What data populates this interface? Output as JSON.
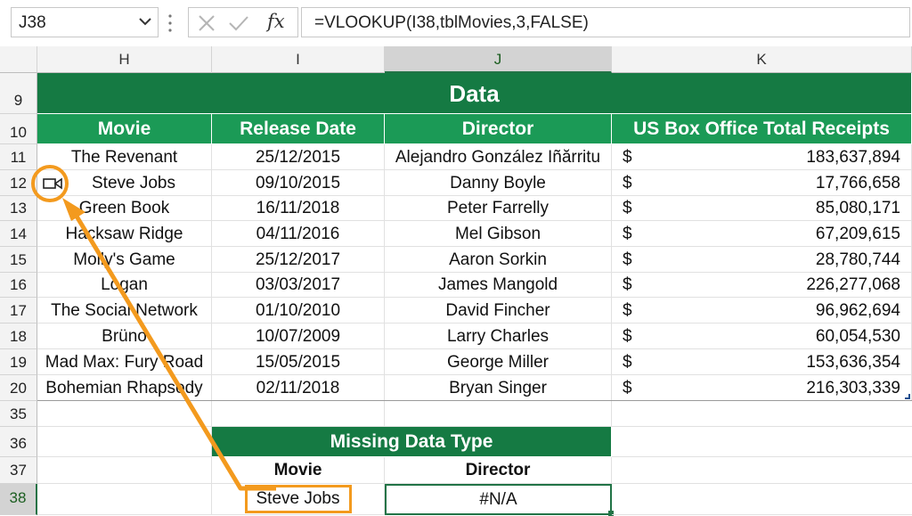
{
  "formula_bar": {
    "name_box": "J38",
    "formula": "=VLOOKUP(I38,tblMovies,3,FALSE)",
    "fx_label": "fx"
  },
  "columns": [
    "H",
    "I",
    "J",
    "K"
  ],
  "rows": {
    "r9": "9",
    "r10": "10",
    "r11": "11",
    "r12": "12",
    "r13": "13",
    "r14": "14",
    "r15": "15",
    "r16": "16",
    "r17": "17",
    "r18": "18",
    "r19": "19",
    "r20": "20",
    "r35": "35",
    "r36": "36",
    "r37": "37",
    "r38": "38"
  },
  "data_table": {
    "title": "Data",
    "headers": [
      "Movie",
      "Release Date",
      "Director",
      "US Box Office Total Receipts"
    ],
    "currency_symbol": "$",
    "rows": [
      {
        "movie": "The Revenant",
        "date": "25/12/2015",
        "director": "Alejandro González Iñărritu",
        "receipts": "183,637,894"
      },
      {
        "movie": "Steve Jobs",
        "date": "09/10/2015",
        "director": "Danny Boyle",
        "receipts": "17,766,658"
      },
      {
        "movie": "Green Book",
        "date": "16/11/2018",
        "director": "Peter Farrelly",
        "receipts": "85,080,171"
      },
      {
        "movie": "Hacksaw Ridge",
        "date": "04/11/2016",
        "director": "Mel Gibson",
        "receipts": "67,209,615"
      },
      {
        "movie": "Molly's Game",
        "date": "25/12/2017",
        "director": "Aaron Sorkin",
        "receipts": "28,780,744"
      },
      {
        "movie": "Logan",
        "date": "03/03/2017",
        "director": "James Mangold",
        "receipts": "226,277,068"
      },
      {
        "movie": "The Social Network",
        "date": "01/10/2010",
        "director": "David Fincher",
        "receipts": "96,962,694"
      },
      {
        "movie": "Brüno",
        "date": "10/07/2009",
        "director": "Larry Charles",
        "receipts": "60,054,530"
      },
      {
        "movie": "Mad Max: Fury Road",
        "date": "15/05/2015",
        "director": "George Miller",
        "receipts": "153,636,354"
      },
      {
        "movie": "Bohemian Rhapsody",
        "date": "02/11/2018",
        "director": "Bryan Singer",
        "receipts": "216,303,339"
      }
    ]
  },
  "missing_table": {
    "title": "Missing Data Type",
    "headers": [
      "Movie",
      "Director"
    ],
    "movie": "Steve Jobs",
    "director": "#N/A"
  },
  "colors": {
    "header_green": "#1b9a56",
    "title_green": "#157a43",
    "annotation_orange": "#f39a1e",
    "selection_green": "#217346"
  },
  "icons": {
    "namebox_dropdown": "chevron-down-icon",
    "cancel": "x-icon",
    "enter": "check-icon",
    "function": "fx-icon",
    "video_data_type": "video-camera-icon"
  }
}
